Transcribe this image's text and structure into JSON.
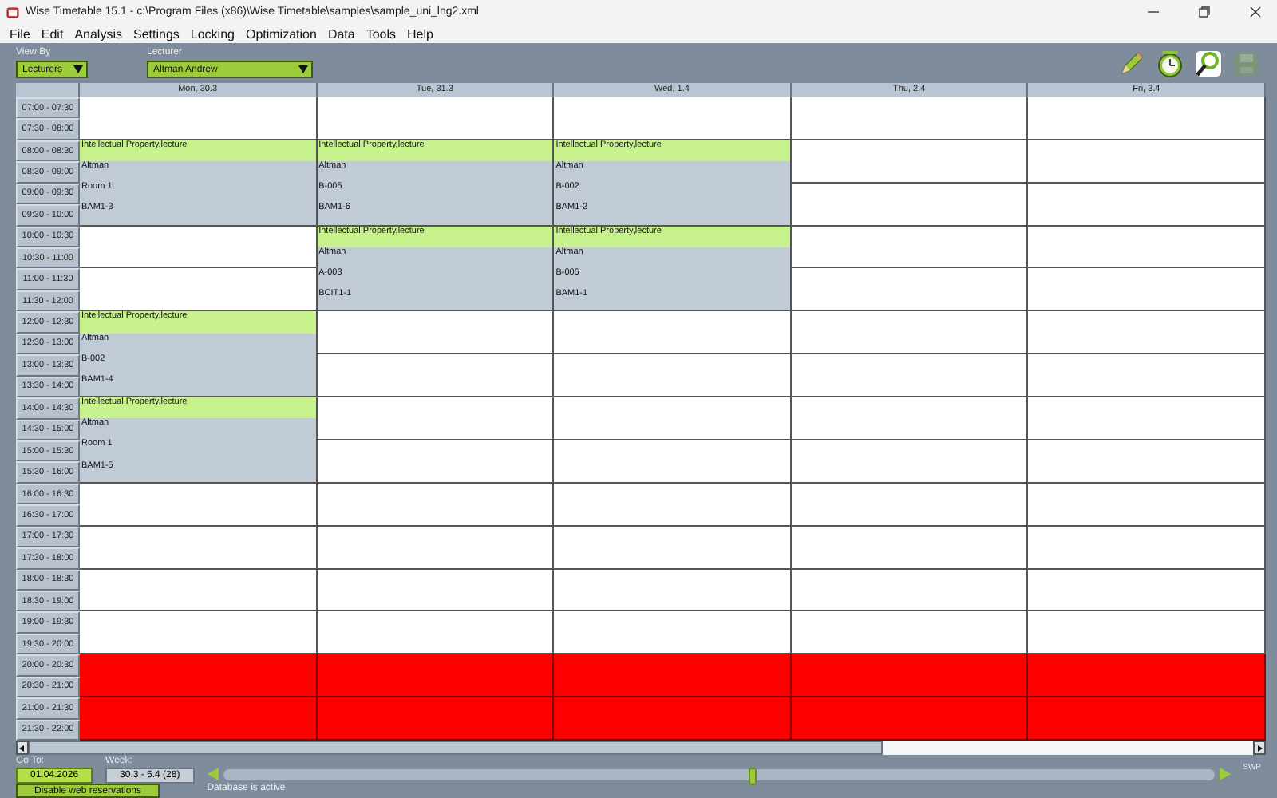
{
  "window": {
    "title": "Wise Timetable 15.1 - c:\\Program Files (x86)\\Wise Timetable\\samples\\sample_uni_lng2.xml"
  },
  "menu": [
    "File",
    "Edit",
    "Analysis",
    "Settings",
    "Locking",
    "Optimization",
    "Data",
    "Tools",
    "Help"
  ],
  "toolbar": {
    "view_by": {
      "label": "View By",
      "value": "Lecturers"
    },
    "lecturer": {
      "label": "Lecturer",
      "value": "Altman Andrew"
    },
    "tools": [
      {
        "kind": "pencil",
        "disabled": false
      },
      {
        "kind": "clock",
        "disabled": false
      },
      {
        "kind": "search",
        "disabled": false
      },
      {
        "kind": "save",
        "disabled": true
      }
    ]
  },
  "timetable": {
    "slots": [
      "07:00 - 07:30",
      "07:30 - 08:00",
      "08:00 - 08:30",
      "08:30 - 09:00",
      "09:00 - 09:30",
      "09:30 - 10:00",
      "10:00 - 10:30",
      "10:30 - 11:00",
      "11:00 - 11:30",
      "11:30 - 12:00",
      "12:00 - 12:30",
      "12:30 - 13:00",
      "13:00 - 13:30",
      "13:30 - 14:00",
      "14:00 - 14:30",
      "14:30 - 15:00",
      "15:00 - 15:30",
      "15:30 - 16:00",
      "16:00 - 16:30",
      "16:30 - 17:00",
      "17:00 - 17:30",
      "17:30 - 18:00",
      "18:00 - 18:30",
      "18:30 - 19:00",
      "19:00 - 19:30",
      "19:30 - 20:00",
      "20:00 - 20:30",
      "20:30 - 21:00",
      "21:00 - 21:30",
      "21:30 - 22:00"
    ],
    "days": [
      {
        "label": "Mon, 30.3",
        "blocks": [
          {
            "kind": "free"
          },
          {
            "kind": "event",
            "title": "Intellectual Property,lecture",
            "lecturer": "Altman",
            "room": "Room 1",
            "group": "BAM1-3"
          },
          {
            "kind": "free"
          },
          {
            "kind": "free"
          },
          {
            "kind": "event",
            "title": "Intellectual Property,lecture",
            "lecturer": "Altman",
            "room": "B-002",
            "group": "BAM1-4"
          },
          {
            "kind": "event",
            "title": "Intellectual Property,lecture",
            "lecturer": "Altman",
            "room": "Room 1",
            "group": "BAM1-5"
          },
          {
            "kind": "free"
          },
          {
            "kind": "free"
          },
          {
            "kind": "free"
          },
          {
            "kind": "free"
          },
          {
            "kind": "unavailable"
          },
          {
            "kind": "unavailable"
          }
        ]
      },
      {
        "label": "Tue, 31.3",
        "blocks": [
          {
            "kind": "free"
          },
          {
            "kind": "event",
            "title": "Intellectual Property,lecture",
            "lecturer": "Altman",
            "room": "B-005",
            "group": "BAM1-6"
          },
          {
            "kind": "event",
            "title": "Intellectual Property,lecture",
            "lecturer": "Altman",
            "room": "A-003",
            "group": "BCIT1-1"
          },
          {
            "kind": "free"
          },
          {
            "kind": "free"
          },
          {
            "kind": "free"
          },
          {
            "kind": "free"
          },
          {
            "kind": "free"
          },
          {
            "kind": "free"
          },
          {
            "kind": "free"
          },
          {
            "kind": "free"
          },
          {
            "kind": "unavailable"
          },
          {
            "kind": "unavailable"
          }
        ]
      },
      {
        "label": "Wed, 1.4",
        "blocks": [
          {
            "kind": "free"
          },
          {
            "kind": "event",
            "title": "Intellectual Property,lecture",
            "lecturer": "Altman",
            "room": "B-002",
            "group": "BAM1-2"
          },
          {
            "kind": "event",
            "title": "Intellectual Property,lecture",
            "lecturer": "Altman",
            "room": "B-006",
            "group": "BAM1-1"
          },
          {
            "kind": "free"
          },
          {
            "kind": "free"
          },
          {
            "kind": "free"
          },
          {
            "kind": "free"
          },
          {
            "kind": "free"
          },
          {
            "kind": "free"
          },
          {
            "kind": "free"
          },
          {
            "kind": "free"
          },
          {
            "kind": "unavailable"
          },
          {
            "kind": "unavailable"
          }
        ]
      },
      {
        "label": "Thu, 2.4",
        "blocks": [
          {
            "kind": "free"
          },
          {
            "kind": "free"
          },
          {
            "kind": "free"
          },
          {
            "kind": "free"
          },
          {
            "kind": "free"
          },
          {
            "kind": "free"
          },
          {
            "kind": "free"
          },
          {
            "kind": "free"
          },
          {
            "kind": "free"
          },
          {
            "kind": "free"
          },
          {
            "kind": "free"
          },
          {
            "kind": "free"
          },
          {
            "kind": "free"
          },
          {
            "kind": "unavailable"
          },
          {
            "kind": "unavailable"
          }
        ]
      },
      {
        "label": "Fri, 3.4",
        "blocks": [
          {
            "kind": "free"
          },
          {
            "kind": "free"
          },
          {
            "kind": "free"
          },
          {
            "kind": "free"
          },
          {
            "kind": "free"
          },
          {
            "kind": "free"
          },
          {
            "kind": "free"
          },
          {
            "kind": "free"
          },
          {
            "kind": "free"
          },
          {
            "kind": "free"
          },
          {
            "kind": "free"
          },
          {
            "kind": "free"
          },
          {
            "kind": "free"
          },
          {
            "kind": "unavailable"
          },
          {
            "kind": "unavailable"
          }
        ]
      }
    ]
  },
  "bottom": {
    "go_to": {
      "label": "Go To:",
      "value": "01.04.2026"
    },
    "week": {
      "label": "Week:",
      "value": "30.3 - 5.4  (28)"
    },
    "web_button": "Disable web reservations",
    "week_slider": {
      "level": 0.53
    },
    "status": "Database is active",
    "mode": "SWP"
  }
}
